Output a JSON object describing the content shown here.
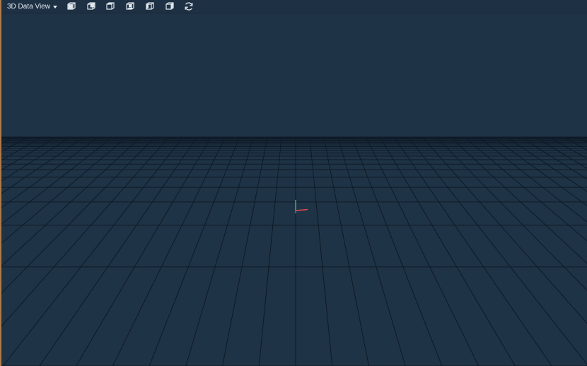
{
  "toolbar": {
    "view_selector": {
      "label": "3D Data View"
    },
    "buttons": [
      {
        "name": "view-front-icon"
      },
      {
        "name": "view-back-icon"
      },
      {
        "name": "view-top-icon"
      },
      {
        "name": "view-bottom-icon"
      },
      {
        "name": "view-left-icon"
      },
      {
        "name": "view-right-icon"
      },
      {
        "name": "reset-view-icon"
      }
    ]
  },
  "viewport": {
    "background_color": "#1f3346",
    "grid_line_color": "#0e1a26",
    "axis_colors": {
      "x": "#e24b4b",
      "y": "#3fc04f",
      "z": "#3b6fe6"
    }
  }
}
